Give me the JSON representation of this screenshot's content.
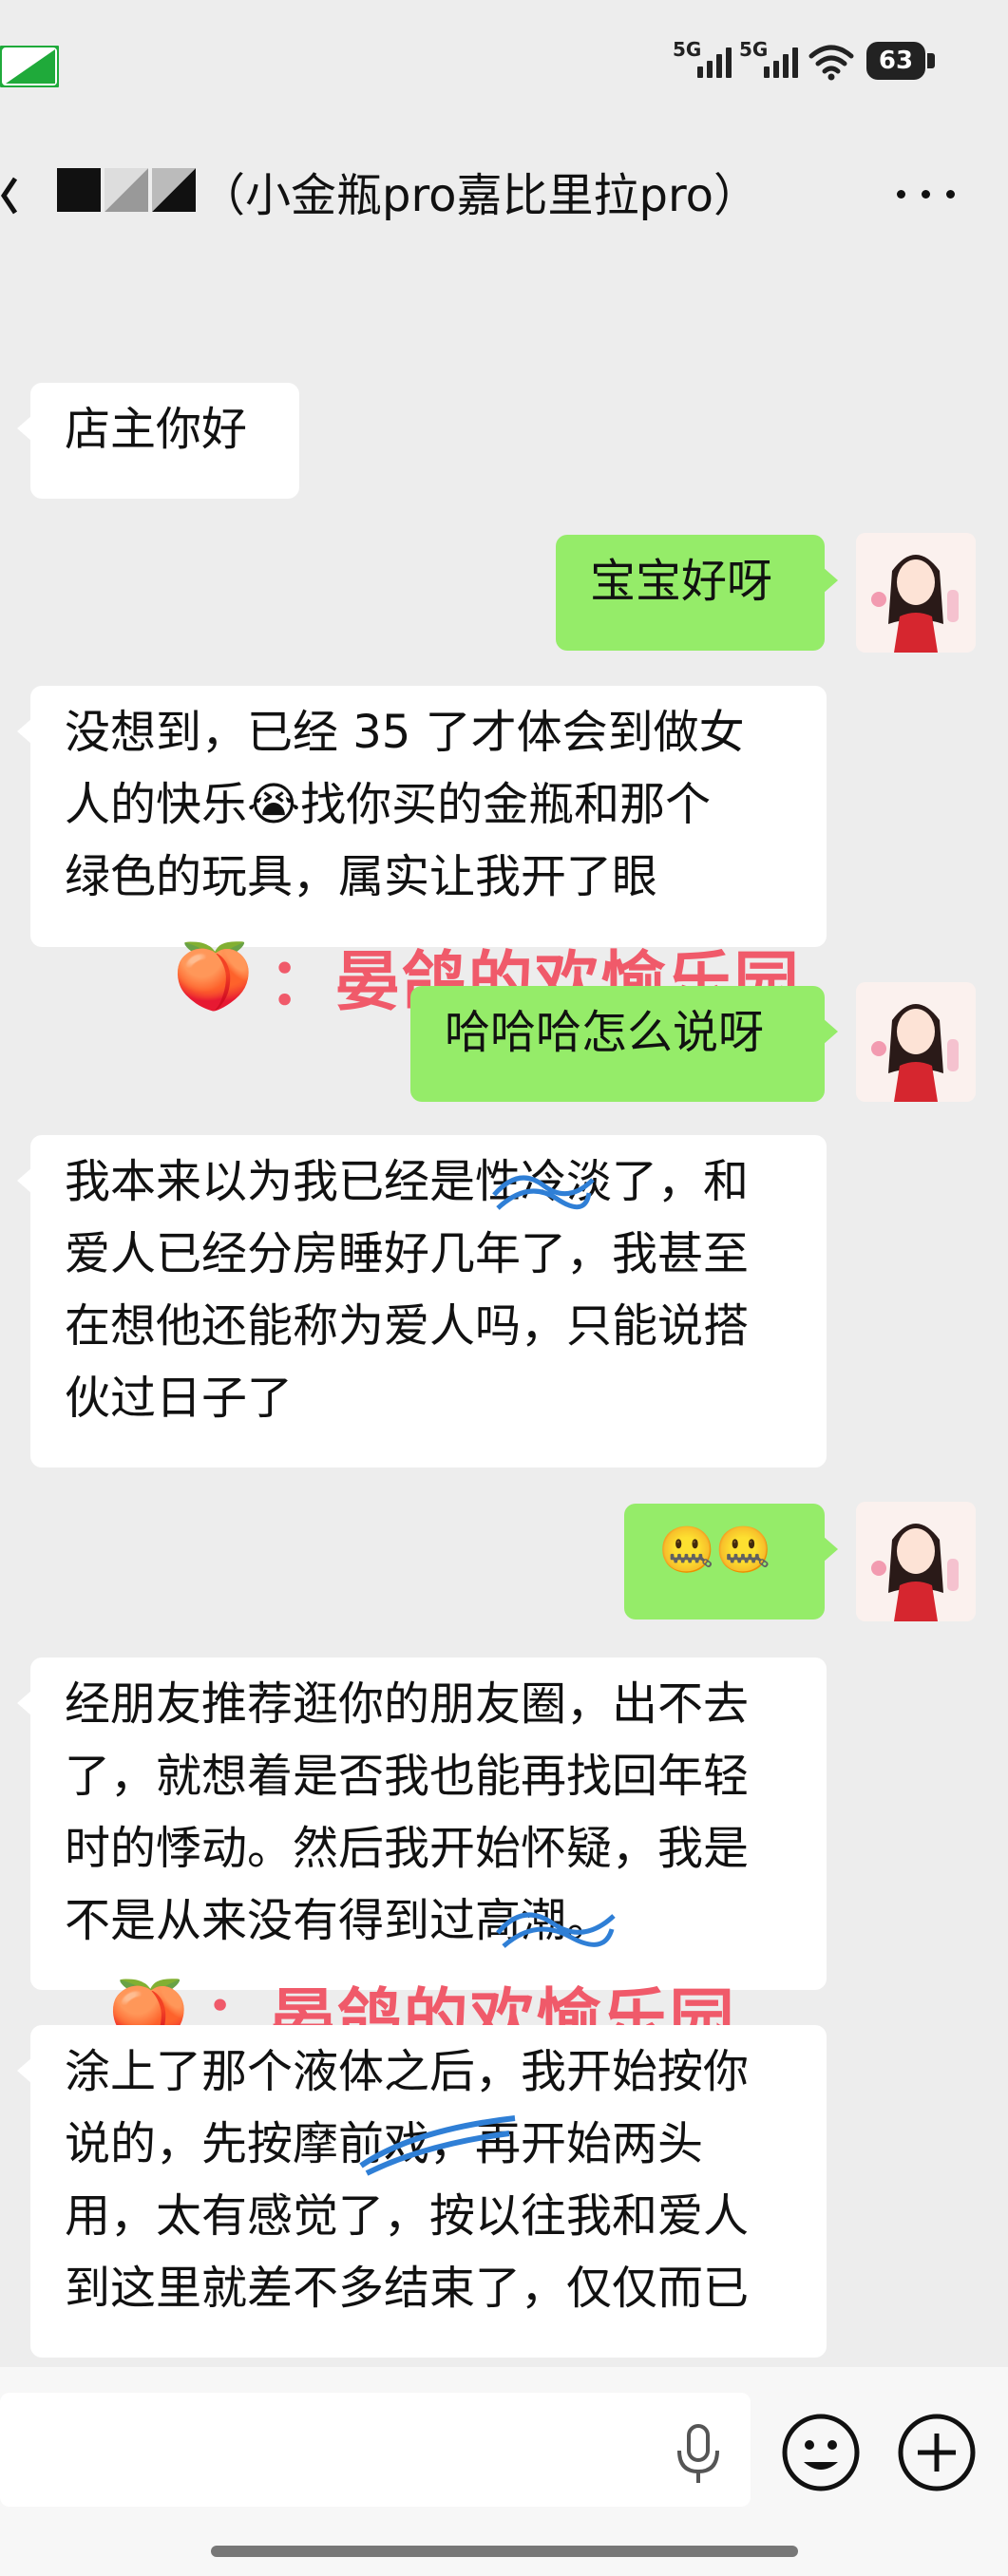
{
  "status_bar": {
    "network_1": "5G",
    "network_2": "5G",
    "battery": "63"
  },
  "header": {
    "title": "（小金瓶pro嘉比里拉pro）",
    "more_icon": "more-dots-icon"
  },
  "messages": [
    {
      "side": "left",
      "text": "店主你好"
    },
    {
      "side": "right",
      "text": "宝宝好呀"
    },
    {
      "side": "left",
      "lines": [
        "没想到，已经 35 了才体会到做女",
        "人的快乐😭找你买的金瓶和那个",
        "绿色的玩具，属实让我开了眼"
      ]
    },
    {
      "side": "right",
      "text": "哈哈哈怎么说呀"
    },
    {
      "side": "left",
      "lines": [
        "我本来以为我已经是性冷淡了，和",
        "爱人已经分房睡好几年了，我甚至",
        "在想他还能称为爱人吗，只能说搭",
        "伙过日子了"
      ]
    },
    {
      "side": "right",
      "text": "🤐🤐"
    },
    {
      "side": "left",
      "lines": [
        "经朋友推荐逛你的朋友圈，出不去",
        "了，就想着是否我也能再找回年轻",
        "时的悸动。然后我开始怀疑，我是",
        "不是从来没有得到过高潮。"
      ]
    },
    {
      "side": "left",
      "lines": [
        "涂上了那个液体之后，我开始按你",
        "说的，先按摩前戏，再开始两头",
        "用，太有感觉了，按以往我和爱人",
        "到这里就差不多结束了，仅仅而已"
      ]
    }
  ],
  "watermark": {
    "emoji": "🍑",
    "text": "：晏鸽的欢愉乐园"
  },
  "input_bar": {
    "voice_icon": "microphone-icon",
    "emoji_icon": "smiley-icon",
    "plus_icon": "plus-circle-icon"
  },
  "colors": {
    "background": "#ededed",
    "right_bubble": "#95ec69",
    "left_bubble": "#ffffff",
    "watermark": "#f05a6a"
  }
}
